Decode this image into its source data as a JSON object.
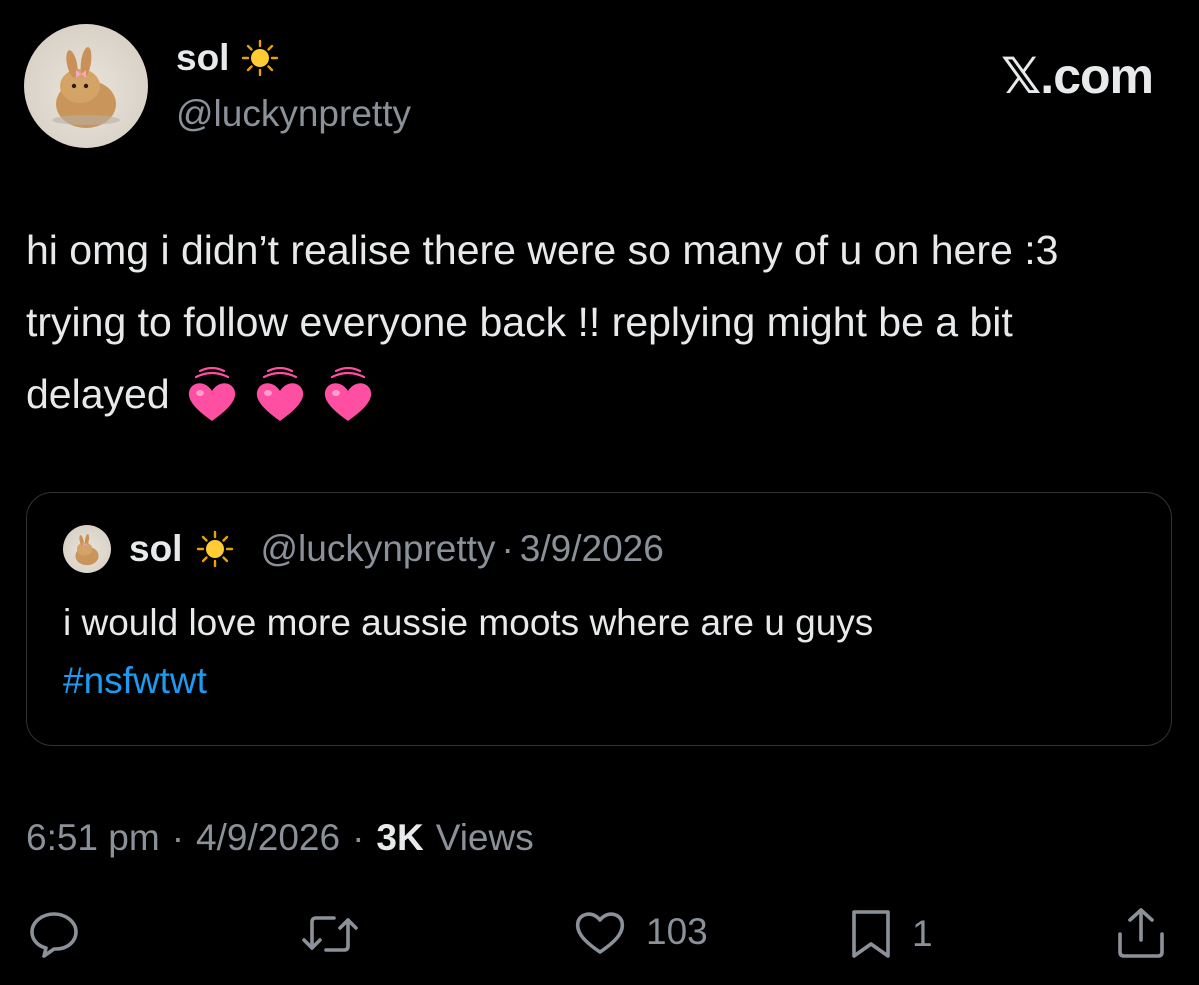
{
  "author": {
    "display_name": "sol",
    "handle": "@luckynpretty"
  },
  "brand": {
    "logo_text": "𝕏.com"
  },
  "tweet": {
    "text": "hi omg i didn’t realise there were so many of u on here :3 trying to follow everyone back !! replying might be a bit delayed",
    "emojis": [
      "heart-icon",
      "heart-icon",
      "heart-icon"
    ]
  },
  "quote": {
    "display_name": "sol",
    "handle": "@luckynpretty",
    "separator": "·",
    "date": "3/9/2026",
    "text": "i would love more aussie moots where are u guys",
    "hashtag": "#nsfwtwt"
  },
  "meta": {
    "time": "6:51 pm",
    "separator": "·",
    "date": "4/9/2026",
    "views_count": "3K",
    "views_label": "Views"
  },
  "actions": {
    "reply_count": "",
    "retweet_count": "",
    "like_count": "103",
    "bookmark_count": "1"
  },
  "colors": {
    "background": "#000000",
    "text": "#e7e9ea",
    "secondary": "#8b9198",
    "link": "#1d9bf0",
    "heart": "#ff4fa3"
  }
}
